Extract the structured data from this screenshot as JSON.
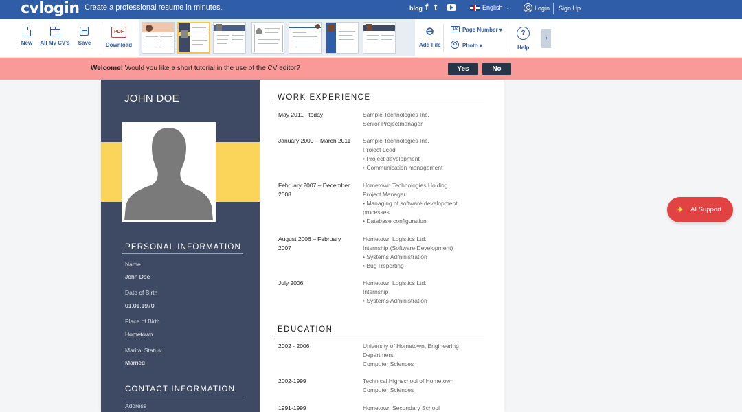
{
  "topbar": {
    "logo": "cvlogin",
    "tagline": "Create a professional resume in minutes.",
    "blog": "blog",
    "social": [
      "f",
      "t",
      "yt"
    ],
    "language": "English",
    "login": "Login",
    "signup": "Sign Up"
  },
  "toolbar": {
    "new": "New",
    "all_cvs": "All My CV's",
    "save": "Save",
    "download": "Download",
    "pdf_badge": "PDF",
    "add_file": "Add File",
    "page_number": "Page Number ▾",
    "photo": "Photo ▾",
    "help": "Help",
    "templates": [
      "template-1",
      "template-2",
      "template-3",
      "template-4",
      "template-5",
      "template-6",
      "template-7"
    ]
  },
  "banner": {
    "bold": "Welcome!",
    "text": " Would you like a short tutorial in the use of the CV editor?",
    "yes": "Yes",
    "no": "No"
  },
  "cv": {
    "name": "JOHN DOE",
    "personal_heading": "PERSONAL INFORMATION",
    "personal": [
      {
        "label": "Name",
        "value": "John Doe"
      },
      {
        "label": "Date of Birth",
        "value": "01.01.1970"
      },
      {
        "label": "Place of Birth",
        "value": "Hometown"
      },
      {
        "label": "Marital Status",
        "value": "Married"
      }
    ],
    "contact_heading": "CONTACT INFORMATION",
    "contact_first_label": "Address",
    "work_heading": "WORK EXPERIENCE",
    "work": [
      {
        "date": "May 2011 - today",
        "lines": [
          "Sample Technologies Inc.",
          "Senior Projectmanager"
        ]
      },
      {
        "date": "January 2009 – March 2011",
        "lines": [
          "Sample Technologies Inc.",
          "Project Lead",
          "• Project development",
          "• Communication management"
        ]
      },
      {
        "date": "February 2007 – December 2008",
        "lines": [
          "Hometown Technologies Holding",
          "Project Manager",
          "• Managing of software development processes",
          "• Database configuration"
        ]
      },
      {
        "date": "August 2006 – February 2007",
        "lines": [
          "Hometown Logistics Ltd.",
          "Internship (Software Development)",
          "• Systems Administration",
          "• Bug Reporting"
        ]
      },
      {
        "date": "July 2006",
        "lines": [
          "Hometown Logistics Ltd.",
          "Internship",
          "• Systems Administration"
        ]
      }
    ],
    "education_heading": "EDUCATION",
    "education": [
      {
        "date": "2002 - 2006",
        "lines": [
          "University of Hometown, Engineering Department",
          "Computer Sciences"
        ]
      },
      {
        "date": "2002-1999",
        "lines": [
          "Technical Highschool of Hometown",
          "Computer Sciences"
        ]
      },
      {
        "date": "1991-1999",
        "lines": [
          "Hometown Secondary School"
        ]
      }
    ]
  },
  "ai_support": "AI Support",
  "colors": {
    "brand": "#2f5da8",
    "banner": "#f99a98",
    "cv_sidebar": "#3e4a64",
    "cv_accent": "#fbd45a",
    "ai_button": "#e14343"
  }
}
